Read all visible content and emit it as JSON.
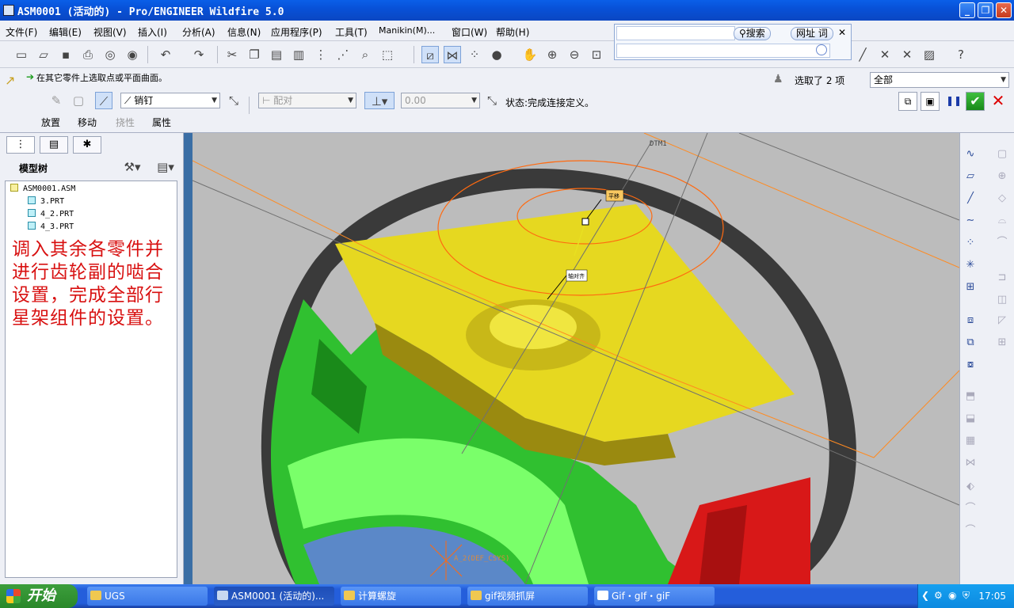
{
  "window": {
    "title": "ASM0001 (活动的) - Pro/ENGINEER Wildfire 5.0",
    "controls": {
      "minimize": "_",
      "maximize": "❐",
      "close": "✕"
    }
  },
  "menu": {
    "items": [
      "文件(F)",
      "编辑(E)",
      "视图(V)",
      "插入(I)",
      "分析(A)",
      "信息(N)",
      "应用程序(P)",
      "工具(T)",
      "Manikin(M)...",
      "窗口(W)",
      "帮助(H)"
    ]
  },
  "search_popup": {
    "search_label": "搜索",
    "url_label": "网址 词",
    "close": "✕"
  },
  "toolbar": {
    "icons": [
      "new-icon",
      "open-icon",
      "save-icon",
      "print-icon",
      "email-icon",
      "undo-icon",
      "redo-icon",
      "cut-icon",
      "copy-icon",
      "paste-icon",
      "regenerate-icon",
      "find-icon",
      "select-box-icon",
      "datum-display-icon",
      "zoom-in-icon",
      "zoom-out-icon",
      "refit-icon",
      "help-icon"
    ]
  },
  "dashboard": {
    "prompt": "在其它零件上选取点或平面曲面。",
    "selection_count": "选取了 2 项",
    "filter_value": "全部",
    "connection_type": "销钉",
    "constraint_type": "配对",
    "offset_value": "0.00",
    "status": "状态:完成连接定义。",
    "tabs": [
      "放置",
      "移动",
      "挠性",
      "属性"
    ]
  },
  "model_tree": {
    "header": "模型树",
    "nodes": [
      "ASM0001.ASM",
      "3.PRT",
      "4_2.PRT",
      "4_3.PRT"
    ],
    "annotation": "调入其余各零件并进行齿轮副的啮合设置，完成全部行星架组件的设置。"
  },
  "viewport": {
    "datum_label": "DTM1",
    "tag_1": "平移",
    "tag_2": "轴对齐",
    "csys_label": "A_2(DEF_CSYS)"
  },
  "taskbar": {
    "start": "开始",
    "tasks": [
      "UGS",
      "ASM0001 (活动的)...",
      "计算螺旋",
      "gif视频抓屏",
      "Gif・gIf・giF"
    ],
    "clock": "17:05"
  },
  "colors": {
    "gear_yellow": "#e6d820",
    "gear_green": "#30c030",
    "gear_red": "#d81818",
    "ring_dark": "#3a3a3a",
    "annotation_red": "#d81010"
  }
}
